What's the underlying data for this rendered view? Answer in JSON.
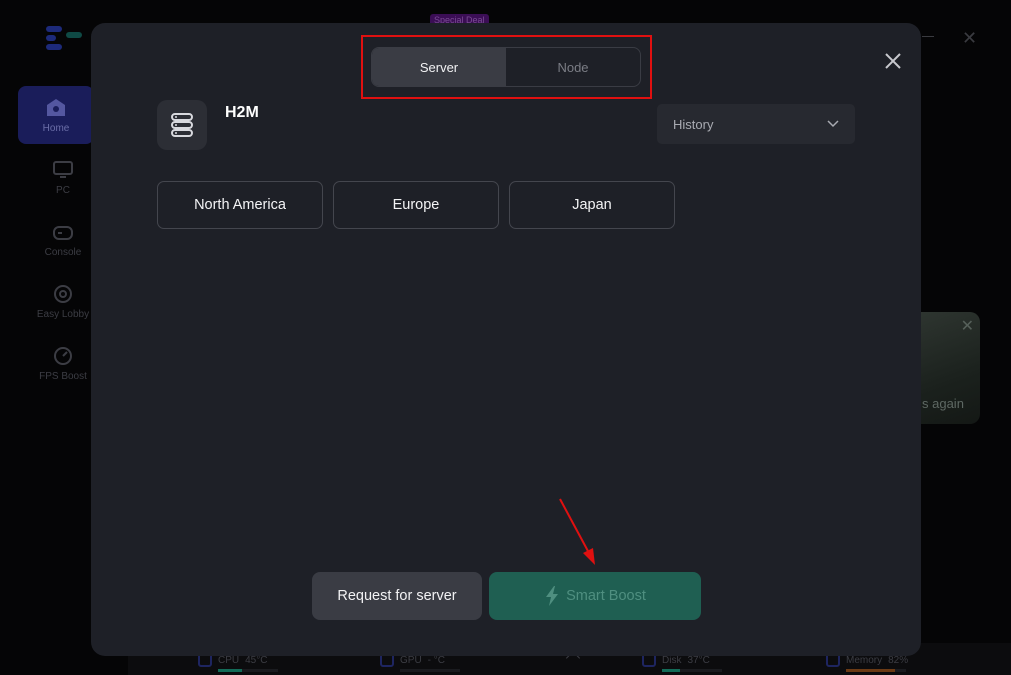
{
  "background": {
    "deal_badge": "Special Deal",
    "nav": [
      {
        "label": "Home",
        "icon": "home-icon"
      },
      {
        "label": "PC",
        "icon": "monitor-icon"
      },
      {
        "label": "Console",
        "icon": "gamepad-icon"
      },
      {
        "label": "Easy Lobby",
        "icon": "crosshair-icon"
      },
      {
        "label": "FPS Boost",
        "icon": "speedometer-icon"
      }
    ],
    "promo_text": "s again",
    "status": [
      {
        "label": "CPU",
        "value": "45°C",
        "level": 0.4
      },
      {
        "label": "GPU",
        "value": "- °C",
        "level": 0
      },
      {
        "label": "Disk",
        "value": "37°C",
        "level": 0.3
      },
      {
        "label": "Memory",
        "value": "82%",
        "level": 0.82
      }
    ]
  },
  "modal": {
    "tabs": [
      "Server",
      "Node"
    ],
    "active_tab": "Server",
    "game_name": "H2M",
    "history_label": "History",
    "regions": [
      "North America",
      "Europe",
      "Japan"
    ],
    "request_label": "Request for server",
    "boost_label": "Smart Boost"
  },
  "colors": {
    "highlight": "#e01010",
    "accent_green": "#1f5f52",
    "modal_bg": "#1e2027"
  }
}
